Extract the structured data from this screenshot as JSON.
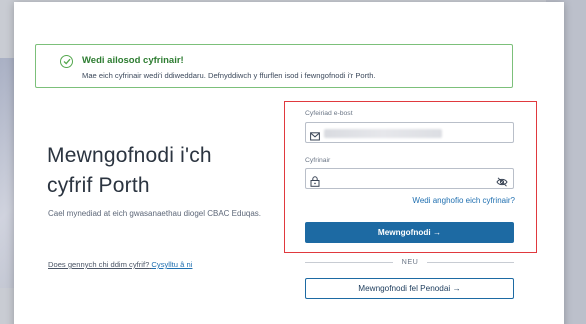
{
  "alert": {
    "title": "Wedi ailosod cyfrinair!",
    "message": "Mae eich cyfrinair wedi'i ddiweddaru. Defnyddiwch y ffurflen isod i fewngofnodi i'r Porth."
  },
  "intro": {
    "heading_line1": "Mewngofnodi i'ch",
    "heading_line2": "cyfrif Porth",
    "description": "Cael mynediad at eich gwasanaethau diogel CBAC Eduqas.",
    "no_account": "Does gennych chi ddim cyfrif?",
    "contact_link": "Cysylltu â ni"
  },
  "form": {
    "email_label": "Cyfeiriad e-bost",
    "password_label": "Cyfrinair",
    "forgot_link": "Wedi anghofio eich cyfrinair?",
    "login_button": "Mewngofnodi →",
    "or_label": "NEU",
    "delegate_button": "Mewngofnodi fel Penodai →"
  },
  "icons": {
    "alert": "check-circle-icon",
    "email": "envelope-icon",
    "password": "lock-icon",
    "visibility": "eye-off-icon"
  },
  "colors": {
    "success": "#2e7d32",
    "primary": "#1d6aa3",
    "link": "#1f6fb0",
    "highlight": "#e0393e"
  }
}
